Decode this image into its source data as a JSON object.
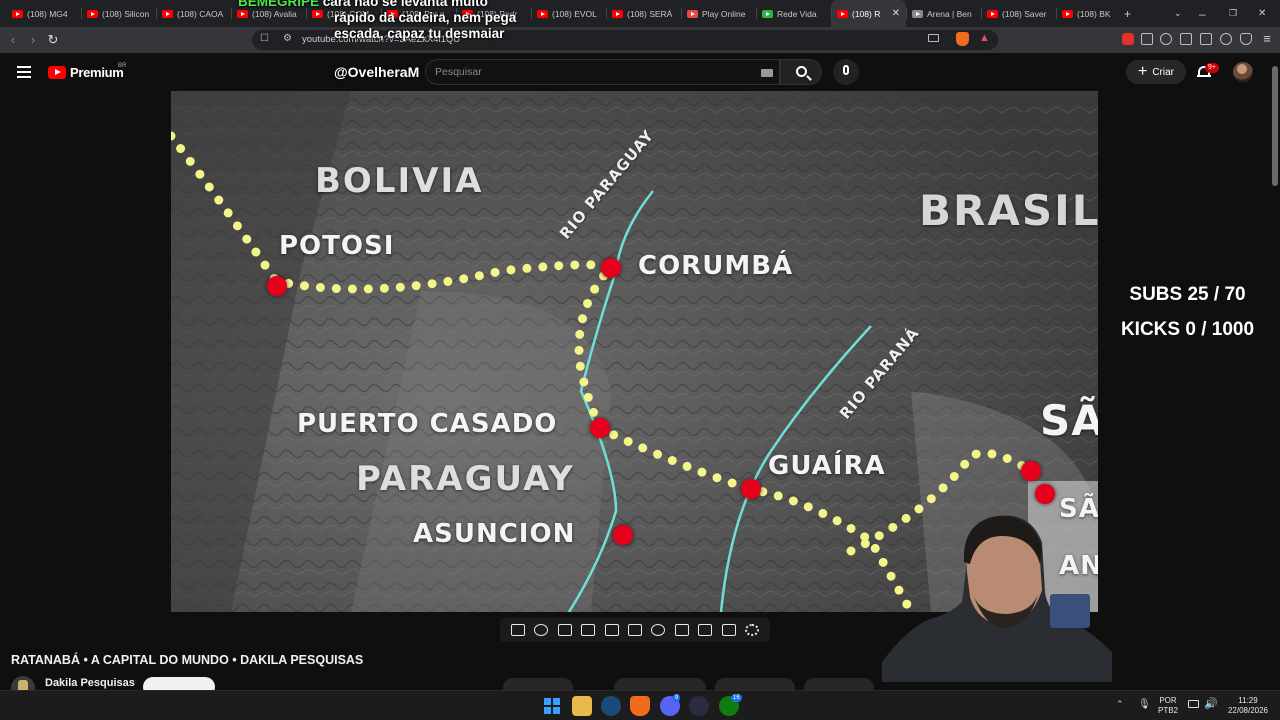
{
  "browser": {
    "tabs": [
      {
        "label": "(108) MG4",
        "icon": "youtube-favicon"
      },
      {
        "label": "(108) Silicon",
        "icon": "youtube-favicon"
      },
      {
        "label": "(108) CAOA",
        "icon": "youtube-favicon"
      },
      {
        "label": "(108) Avalia",
        "icon": "youtube-favicon"
      },
      {
        "label": "(108) COM",
        "icon": "youtube-favicon"
      },
      {
        "label": "(108) Por q",
        "icon": "youtube-favicon"
      },
      {
        "label": "(108) Podr",
        "icon": "youtube-favicon"
      },
      {
        "label": "(108) EVOL",
        "icon": "youtube-favicon"
      },
      {
        "label": "(108) SERÁ",
        "icon": "youtube-favicon"
      },
      {
        "label": "Play Online",
        "icon": "play-online-favicon"
      },
      {
        "label": "Rede Vida",
        "icon": "rede-vida-favicon"
      },
      {
        "label": "(108) R",
        "icon": "youtube-favicon",
        "active": true
      },
      {
        "label": "Arena | Ben",
        "icon": "arena-favicon"
      },
      {
        "label": "(108) Saver",
        "icon": "youtube-favicon"
      },
      {
        "label": "(108) BK",
        "icon": "youtube-favicon"
      }
    ],
    "url": "youtube.com/watch?v=2AeZkX4l1QU"
  },
  "youtube": {
    "logo_text": "Premium",
    "region": "BR",
    "search_placeholder": "Pesquisar",
    "create_label": "Criar",
    "notification_count": "9+"
  },
  "stream_overlay": {
    "chat_user": "BEMEGRIPE",
    "chat_line1": "cara não se levanta muito",
    "chat_line2": "rápido da cadeira, nem pega",
    "chat_line3": "escada, capaz tu desmaiar",
    "handle": "@OvelheraM",
    "subs": "SUBS 25 / 70",
    "kicks": "KICKS 0 / 1000"
  },
  "map": {
    "countries": [
      "BOLIVIA",
      "PARAGUAY",
      "BRASIL"
    ],
    "cities": [
      "POTOSI",
      "CORUMBÁ",
      "PUERTO CASADO",
      "ASUNCION",
      "GUAÍRA",
      "SÃ",
      "SÃ",
      "AN"
    ],
    "rivers": [
      "RIO PARAGUAY",
      "RIO PARANÁ"
    ],
    "accent_route": "#f3f58a",
    "accent_river": "#6fe0d8",
    "accent_city": "#e6001c"
  },
  "video": {
    "title": "RATANABÁ • A CAPITAL DO MUNDO • DAKILA PESQUISAS",
    "channel": "Dakila Pesquisas"
  },
  "taskbar": {
    "lang_top": "POR",
    "lang_bottom": "PTB2",
    "time": "11:29",
    "date": "22/08/2026",
    "discord_badge": "9",
    "xbox_badge": "16"
  }
}
